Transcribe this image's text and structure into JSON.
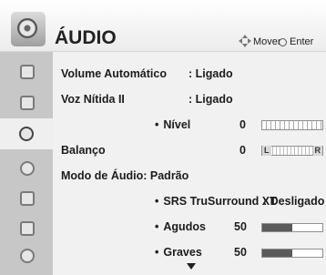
{
  "header": {
    "title": "ÁUDIO",
    "move_hint": "Mover",
    "enter_hint": "Enter"
  },
  "sidebar": {
    "items": [
      {
        "icon": "picture-settings-icon"
      },
      {
        "icon": "screen-icon"
      },
      {
        "icon": "audio-icon",
        "active": true
      },
      {
        "icon": "clock-icon"
      },
      {
        "icon": "option-icon"
      },
      {
        "icon": "lock-icon"
      },
      {
        "icon": "input-icon"
      }
    ]
  },
  "settings": {
    "volume_auto": {
      "label": "Volume Automático",
      "value": ": Ligado"
    },
    "clear_voice": {
      "label": "Voz Nítida II",
      "value": ": Ligado"
    },
    "level": {
      "label": "Nível",
      "value": "0",
      "fraction": 0
    },
    "balance": {
      "label": "Balanço",
      "value": "0",
      "left": "L",
      "right": "R"
    },
    "audio_mode": {
      "label": "Modo de Áudio: Padrão"
    },
    "srs": {
      "label": "SRS TruSurround XT",
      "value": ": Desligado"
    },
    "treble": {
      "label": "Agudos",
      "value": "50",
      "fraction": 0.5
    },
    "bass": {
      "label": "Graves",
      "value": "50",
      "fraction": 0.5
    }
  },
  "colors": {
    "header_bg": "#f4f4f4",
    "sidebar_bg": "#c7c7c7",
    "bar_fill": "#5a5a5a"
  }
}
